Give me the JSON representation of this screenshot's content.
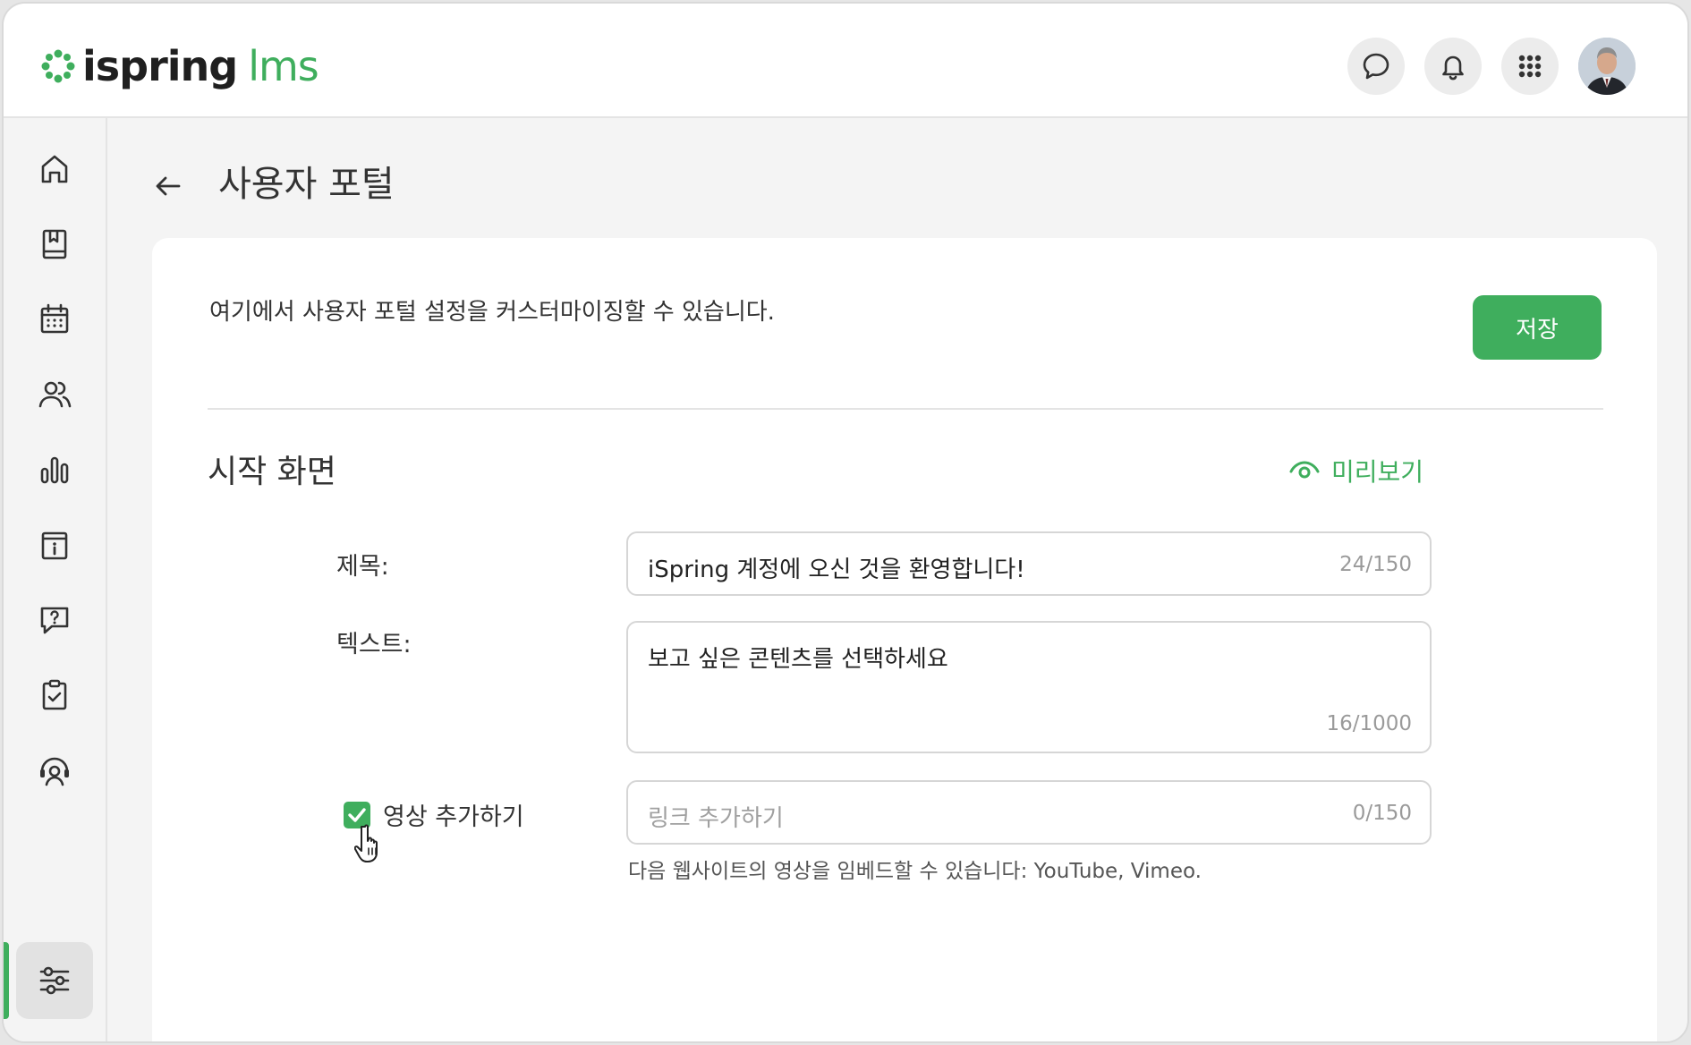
{
  "app": {
    "logo_main": "ispring",
    "logo_sub": "lms"
  },
  "header": {
    "icons": [
      "chat-icon",
      "bell-icon",
      "apps-grid-icon"
    ],
    "avatar": "avatar"
  },
  "sidebar": {
    "items": [
      {
        "icon": "home-icon",
        "active": false
      },
      {
        "icon": "book-icon",
        "active": false
      },
      {
        "icon": "calendar-icon",
        "active": false
      },
      {
        "icon": "users-icon",
        "active": false
      },
      {
        "icon": "bar-chart-icon",
        "active": false
      },
      {
        "icon": "info-calendar-icon",
        "active": false
      },
      {
        "icon": "question-chat-icon",
        "active": false
      },
      {
        "icon": "clipboard-check-icon",
        "active": false
      },
      {
        "icon": "support-agent-icon",
        "active": false
      },
      {
        "icon": "settings-sliders-icon",
        "active": true
      }
    ]
  },
  "page": {
    "title": "사용자 포털",
    "description": "여기에서 사용자 포털 설정을 커스터마이징할 수 있습니다.",
    "save_label": "저장"
  },
  "section": {
    "title": "시작 화면",
    "preview_label": "미리보기",
    "title_label": "제목:",
    "title_value": "iSpring 계정에 오신 것을 환영합니다!",
    "title_counter": "24/150",
    "text_label": "텍스트:",
    "text_value": "보고 싶은 콘텐츠를 선택하세요",
    "text_counter": "16/1000",
    "video_label": "영상 추가하기",
    "video_checked": true,
    "link_placeholder": "링크 추가하기",
    "link_counter": "0/150",
    "hint": "다음 웹사이트의 영상을 임베드할 수 있습니다: YouTube, Vimeo."
  },
  "colors": {
    "accent": "#3fae5d",
    "background": "#f4f4f4",
    "card": "#ffffff"
  }
}
